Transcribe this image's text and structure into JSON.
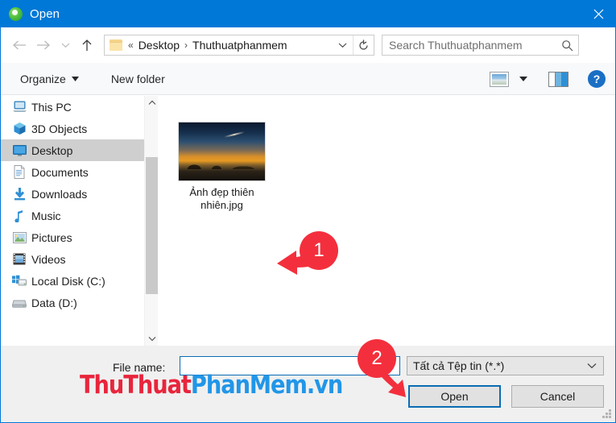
{
  "titlebar": {
    "title": "Open",
    "app_icon": "app-green-circle-icon",
    "close_icon": "close-icon"
  },
  "nav": {
    "back_icon": "arrow-left-icon",
    "forward_icon": "arrow-right-icon",
    "recent_icon": "chevron-down-icon",
    "up_icon": "arrow-up-icon",
    "breadcrumb": {
      "folder_icon": "folder-icon",
      "overflow": "«",
      "separator": "›",
      "crumb1": "Desktop",
      "crumb2": "Thuthuatphanmem",
      "dropdown_icon": "chevron-down-icon",
      "refresh_icon": "refresh-icon"
    },
    "search": {
      "placeholder": "Search Thuthuatphanmem",
      "value": "",
      "icon": "search-icon"
    }
  },
  "toolbar": {
    "organize_label": "Organize",
    "organize_caret": "caret-down-icon",
    "new_folder_label": "New folder",
    "view_icon": "view-layout-icon",
    "view_caret": "caret-down-icon",
    "preview_pane_icon": "preview-pane-icon",
    "help_label": "?",
    "help_icon": "help-icon"
  },
  "sidebar": {
    "items": [
      {
        "label": "This PC",
        "icon": "computer-icon",
        "selected": false
      },
      {
        "label": "3D Objects",
        "icon": "cube-icon",
        "selected": false
      },
      {
        "label": "Desktop",
        "icon": "desktop-icon",
        "selected": true
      },
      {
        "label": "Documents",
        "icon": "document-icon",
        "selected": false
      },
      {
        "label": "Downloads",
        "icon": "download-arrow-icon",
        "selected": false
      },
      {
        "label": "Music",
        "icon": "music-note-icon",
        "selected": false
      },
      {
        "label": "Pictures",
        "icon": "picture-icon",
        "selected": false
      },
      {
        "label": "Videos",
        "icon": "video-film-icon",
        "selected": false
      },
      {
        "label": "Local Disk (C:)",
        "icon": "windows-drive-icon",
        "selected": false
      },
      {
        "label": "Data (D:)",
        "icon": "hard-drive-icon",
        "selected": false
      }
    ],
    "scrollbar": {
      "up_icon": "chevron-up-icon",
      "down_icon": "chevron-down-icon"
    }
  },
  "filelist": {
    "files": [
      {
        "name": "Ảnh đẹp thiên nhiên.jpg",
        "thumbnail": "sunset-landscape-photo"
      }
    ]
  },
  "footer": {
    "filename_label": "File name:",
    "filename_value": "",
    "filetype_value": "Tất cả Tệp tin (*.*)",
    "filetype_caret": "chevron-down-icon",
    "open_label": "Open",
    "cancel_label": "Cancel",
    "resize_grip": "resize-grip-icon"
  },
  "annotations": {
    "marker1": {
      "number": "1",
      "icon": "red-arrow-left-icon"
    },
    "marker2": {
      "number": "2",
      "icon": "red-arrow-down-right-icon"
    }
  },
  "watermark": {
    "part_red": "ThuThuat",
    "part_blue": "PhanMem.vn",
    "red_color": "#e8253c",
    "blue_color": "#2196e8"
  },
  "colors": {
    "titlebar_blue": "#0078d7",
    "accent_blue": "#0a6cb4",
    "marker_red": "#f42f3d",
    "selection_gray": "#cfcfcf",
    "footer_gray": "#f0f0f0"
  }
}
